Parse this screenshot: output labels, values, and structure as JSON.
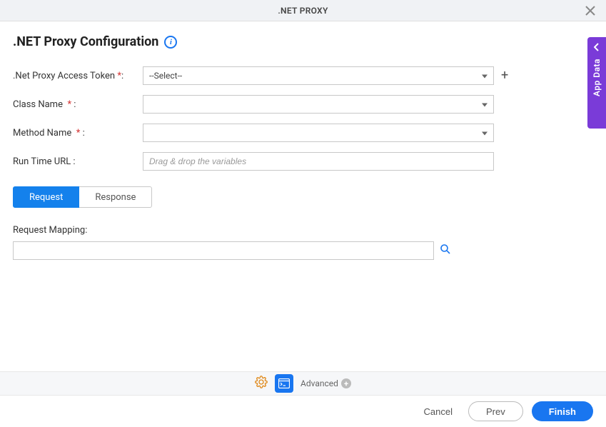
{
  "header": {
    "title": ".NET PROXY"
  },
  "page_title": ".NET Proxy Configuration",
  "form": {
    "access_token_label": ".Net Proxy Access Token",
    "access_token_value": "--Select--",
    "class_name_label": "Class Name",
    "method_name_label": "Method Name",
    "runtime_url_label": "Run Time URL :",
    "runtime_url_placeholder": "Drag & drop the variables",
    "required_marker": "*",
    "colon": ":"
  },
  "tabs": {
    "request": "Request",
    "response": "Response"
  },
  "request_section": {
    "mapping_label": "Request Mapping:"
  },
  "toolbar": {
    "advanced_label": "Advanced"
  },
  "footer": {
    "cancel": "Cancel",
    "prev": "Prev",
    "finish": "Finish"
  },
  "side_panel": {
    "label": "App Data"
  }
}
